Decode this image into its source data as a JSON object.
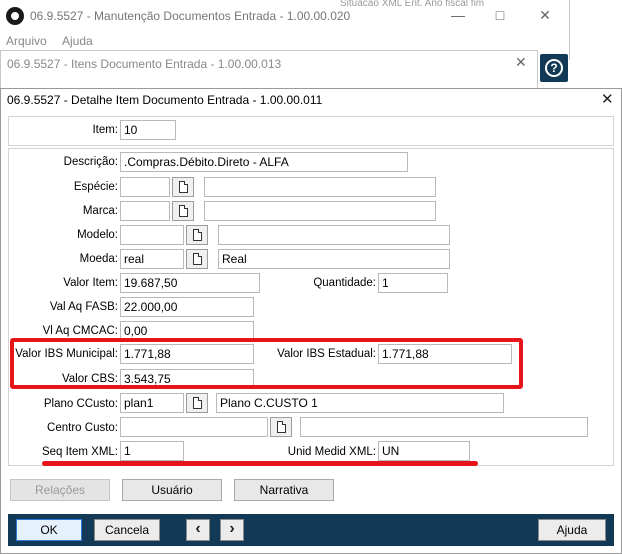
{
  "background_window": {
    "title": "06.9.5527 - Manutenção Documentos Entrada - 1.00.00.020",
    "menu": [
      "Arquivo",
      "Ajuda"
    ],
    "peek_text": "Situacao XML Ent. Ano fiscal fim"
  },
  "items_window": {
    "title": "06.9.5527 - Itens Documento Entrada - 1.00.00.013"
  },
  "dialog": {
    "title": "06.9.5527 - Detalhe Item Documento Entrada - 1.00.00.011"
  },
  "fields": {
    "item": {
      "label": "Item:",
      "value": "10"
    },
    "descricao": {
      "label": "Descrição:",
      "value": ".Compras.Débito.Direto - ALFA"
    },
    "especie": {
      "label": "Espécie:",
      "value": "",
      "desc": ""
    },
    "marca": {
      "label": "Marca:",
      "value": "",
      "desc": ""
    },
    "modelo": {
      "label": "Modelo:",
      "value": "",
      "desc": ""
    },
    "moeda": {
      "label": "Moeda:",
      "value": "real",
      "desc": "Real"
    },
    "valor_item": {
      "label": "Valor Item:",
      "value": "19.687,50"
    },
    "quantidade": {
      "label": "Quantidade:",
      "value": "1"
    },
    "val_aq_fasb": {
      "label": "Val Aq FASB:",
      "value": "22.000,00"
    },
    "vl_aq_cmcac": {
      "label": "Vl Aq CMCAC:",
      "value": "0,00"
    },
    "valor_ibs_municipal": {
      "label": "Valor IBS Municipal:",
      "value": "1.771,88"
    },
    "valor_ibs_estadual": {
      "label": "Valor IBS Estadual:",
      "value": "1.771,88"
    },
    "valor_cbs": {
      "label": "Valor CBS:",
      "value": "3.543,75"
    },
    "plano_ccusto": {
      "label": "Plano CCusto:",
      "value": "plan1",
      "desc": "Plano C.CUSTO 1"
    },
    "centro_custo": {
      "label": "Centro Custo:",
      "value": "",
      "desc": ""
    },
    "seq_item_xml": {
      "label": "Seq Item XML:",
      "value": "1"
    },
    "unid_medid_xml": {
      "label": "Unid Medid XML:",
      "value": "UN"
    }
  },
  "buttons": {
    "relacoes": "Relações",
    "usuario": "Usuário",
    "narrativa": "Narrativa",
    "ok": "OK",
    "cancela": "Cancela",
    "ajuda": "Ajuda"
  },
  "icons": {
    "lookup": "document-icon",
    "prev": "chevron-left-icon",
    "next": "chevron-right-icon",
    "help": "question-icon",
    "close": "close-icon"
  },
  "colors": {
    "bottom_bar": "#123a57",
    "highlight": "#e8141c"
  }
}
